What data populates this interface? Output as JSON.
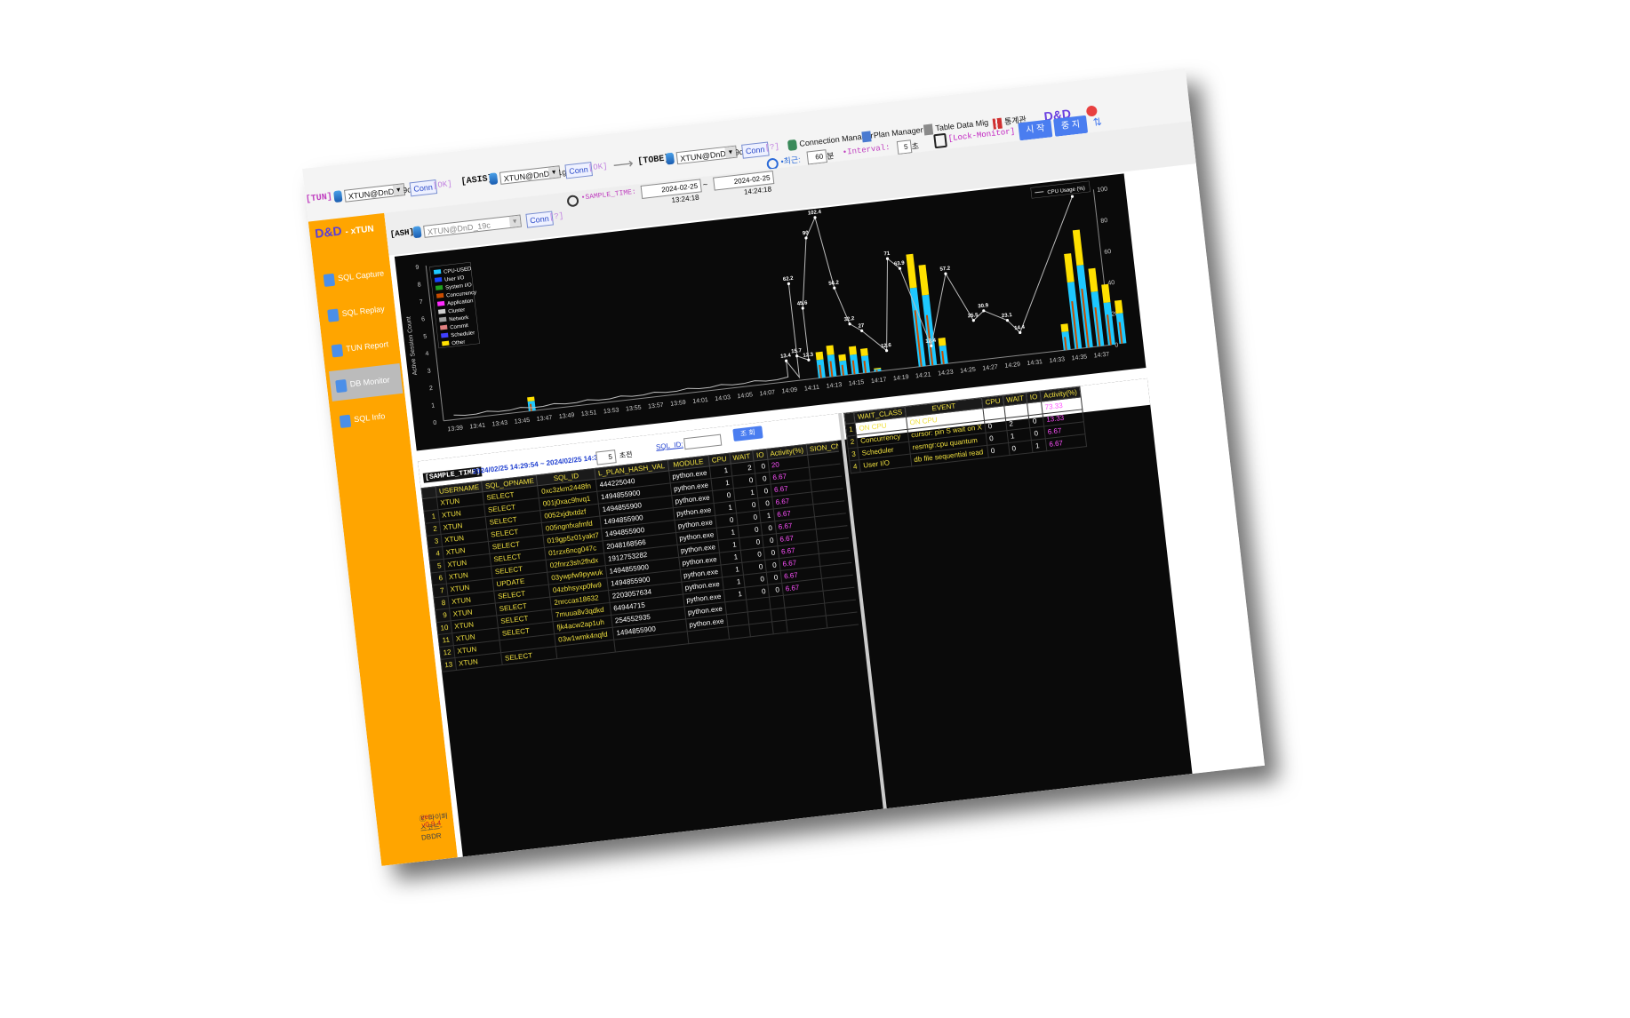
{
  "toolbar": {
    "tun_label": "[TUN]",
    "tun_db": "XTUN@DnD_19c",
    "tun_conn": "Conn",
    "tun_status": "[OK]",
    "asis_label": "[ASIS]",
    "asis_db": "XTUN@DnD_11g",
    "asis_conn": "Conn",
    "asis_status": "[OK]",
    "tobe_label": "[TOBE]",
    "tobe_db": "XTUN@DnD_19c",
    "tobe_conn": "Conn",
    "tobe_status": "[?]",
    "connection_manager": "Connection Manager",
    "plan_manager": "Plan Manager",
    "table_data_mig": "Table Data Mig",
    "tool_4": "통계관",
    "brand": "D&D",
    "recent_label": "•최근:",
    "recent_value": "60",
    "recent_unit": "분",
    "interval_label": "•Interval:",
    "interval_value": "5",
    "interval_unit": "초",
    "lock_monitor": "[Lock-Monitor]",
    "start_btn": "시 작",
    "stop_btn": "중 지"
  },
  "ash": {
    "label": "[ASH]",
    "db": "XTUN@DnD_19c",
    "conn": "Conn",
    "status": "[?]",
    "sample_time_label": "•SAMPLE_TIME:",
    "from": "2024-02-25 13:24:18",
    "sep": "~",
    "to": "2024-02-25 14:24:18"
  },
  "sidebar": {
    "logo": "D&D",
    "logo_suffix": "- xTUN",
    "items": [
      {
        "label": "SQL Capture",
        "icon": "capture-icon"
      },
      {
        "label": "SQL Replay",
        "icon": "replay-icon"
      },
      {
        "label": "TUN Report",
        "icon": "report-icon"
      },
      {
        "label": "DB Monitor",
        "icon": "monitor-icon"
      },
      {
        "label": "SQL Info",
        "icon": "info-icon"
      }
    ],
    "version": "ver.: v0.9.4",
    "copyright": "Ⓒ 라이퍼스코드-DBDR"
  },
  "chart_data": {
    "type": "area",
    "ylabel": "Active Session Count",
    "ylim": [
      0,
      9
    ],
    "y2lim": [
      0,
      100
    ],
    "y2ticks": [
      0,
      20,
      40,
      60,
      80,
      100
    ],
    "categories": [
      "13:39",
      "13:41",
      "13:43",
      "13:45",
      "13:47",
      "13:49",
      "13:51",
      "13:53",
      "13:55",
      "13:57",
      "13:59",
      "14:01",
      "14:03",
      "14:05",
      "14:07",
      "14:09",
      "14:11",
      "14:13",
      "14:15",
      "14:17",
      "14:19",
      "14:21",
      "14:23",
      "14:25",
      "14:27",
      "14:29",
      "14:31",
      "14:33",
      "14:35",
      "14:37"
    ],
    "legend": [
      "CPU-USED",
      "User I/O",
      "System I/O",
      "Concurrency",
      "Application",
      "Cluster",
      "Network",
      "Commit",
      "Scheduler",
      "Other"
    ],
    "colors": {
      "CPU-USED": "#1ec8ff",
      "User I/O": "#1a44ff",
      "System I/O": "#1fa01f",
      "Concurrency": "#c84c00",
      "Application": "#ff2bff",
      "Cluster": "#d0d0d0",
      "Network": "#a0a0a0",
      "Commit": "#e08080",
      "Scheduler": "#4040ff",
      "Other": "#ffe000"
    },
    "cpu_usage_legend": "CPU Usage (%)",
    "cpu_usage_labels": [
      {
        "x": "14:09",
        "y": 13.4
      },
      {
        "x": "14:10",
        "y": 62.2
      },
      {
        "x": "14:10",
        "y": 15.7
      },
      {
        "x": "14:11",
        "y": 12.3
      },
      {
        "x": "14:11",
        "y": 45.6
      },
      {
        "x": "14:12",
        "y": 90
      },
      {
        "x": "14:13",
        "y": 102.4
      },
      {
        "x": "14:14",
        "y": 56.2
      },
      {
        "x": "14:15",
        "y": 32.2
      },
      {
        "x": "14:16",
        "y": 27
      },
      {
        "x": "14:18",
        "y": 12.6
      },
      {
        "x": "14:19",
        "y": 71
      },
      {
        "x": "14:20",
        "y": 63.9
      },
      {
        "x": "14:22",
        "y": 12.4
      },
      {
        "x": "14:24",
        "y": 57.2
      },
      {
        "x": "14:26",
        "y": 25.5
      },
      {
        "x": "14:27",
        "y": 30.9
      },
      {
        "x": "14:29",
        "y": 23.1
      },
      {
        "x": "14:30",
        "y": 14.4
      },
      {
        "x": "14:36",
        "y": 97.1
      }
    ],
    "sessions_by_minute": [
      0,
      0,
      0,
      0,
      0,
      0,
      0,
      0.8,
      0,
      0,
      0,
      0,
      0,
      0,
      0,
      0,
      0,
      0,
      0,
      0,
      0,
      0,
      0,
      0,
      0,
      0,
      0,
      0,
      0,
      0,
      0,
      0,
      0,
      1.5,
      1.8,
      1.2,
      1.6,
      1.4,
      0.2,
      0,
      0,
      0,
      6.5,
      5.8,
      1.5,
      0,
      0,
      0,
      0,
      0,
      0,
      0,
      0,
      0,
      0,
      1.5,
      5.5,
      6.8,
      4.5,
      3.5,
      2.5
    ]
  },
  "lower_left": {
    "sample_time_label": "[SAMPLE_TIME]",
    "range": "2024/02/25 14:29:54 ~ 2024/02/25 14:30:52",
    "top_value": "5",
    "top_unit": "초전",
    "sql_id_label": "SQL_ID:",
    "query_btn": "조 회",
    "headers": [
      "",
      "USERNAME",
      "SQL_OPNAME",
      "SQL_ID",
      "L_PLAN_HASH_VAL",
      "MODULE",
      "CPU",
      "WAIT",
      "IO",
      "Activity(%)",
      "SION_CNT"
    ],
    "rows": [
      [
        "",
        "XTUN",
        "SELECT",
        "0xc3zkm2448fn",
        "444225040",
        "python.exe",
        "1",
        "2",
        "0",
        "20",
        "1"
      ],
      [
        "1",
        "XTUN",
        "SELECT",
        "001j0xac9hvq1",
        "1494855900",
        "python.exe",
        "1",
        "0",
        "0",
        "6.67",
        "1"
      ],
      [
        "2",
        "XTUN",
        "SELECT",
        "0052xjdtxtdzf",
        "1494855900",
        "python.exe",
        "0",
        "1",
        "0",
        "6.67",
        "1"
      ],
      [
        "3",
        "XTUN",
        "SELECT",
        "005ngnfxafmfd",
        "1494855900",
        "python.exe",
        "1",
        "0",
        "0",
        "6.67",
        "1"
      ],
      [
        "4",
        "XTUN",
        "SELECT",
        "019gp5z01yakt7",
        "1494855900",
        "python.exe",
        "0",
        "0",
        "1",
        "6.67",
        "1"
      ],
      [
        "5",
        "XTUN",
        "SELECT",
        "01rzx6ncg047c",
        "2048168566",
        "python.exe",
        "1",
        "0",
        "0",
        "6.67",
        "1"
      ],
      [
        "6",
        "XTUN",
        "SELECT",
        "02fnrz3sh2fhdx",
        "1912753282",
        "python.exe",
        "1",
        "0",
        "0",
        "6.67",
        "1"
      ],
      [
        "7",
        "XTUN",
        "UPDATE",
        "03ywpfw9pywuk",
        "1494855900",
        "python.exe",
        "1",
        "0",
        "0",
        "6.67",
        "1"
      ],
      [
        "8",
        "XTUN",
        "SELECT",
        "04zbhsyxp0fw9",
        "1494855900",
        "python.exe",
        "1",
        "0",
        "0",
        "6.67",
        "1"
      ],
      [
        "9",
        "XTUN",
        "SELECT",
        "2nrccas18632",
        "2203057634",
        "python.exe",
        "1",
        "0",
        "0",
        "6.67",
        "1"
      ],
      [
        "10",
        "XTUN",
        "SELECT",
        "7muua8v3qdkd",
        "64944715",
        "python.exe",
        "1",
        "0",
        "0",
        "6.67",
        "1"
      ],
      [
        "11",
        "XTUN",
        "SELECT",
        "fjk4acw2ap1uh",
        "254552935",
        "python.exe",
        "",
        "",
        "",
        "",
        ""
      ],
      [
        "12",
        "XTUN",
        "",
        "03w1wmk4nqfd",
        "1494855900",
        "python.exe",
        "",
        "",
        "",
        "",
        ""
      ],
      [
        "13",
        "XTUN",
        "SELECT",
        "",
        "",
        "",
        "",
        "",
        "",
        "",
        ""
      ]
    ]
  },
  "lower_right": {
    "headers": [
      "",
      "WAIT_CLASS",
      "EVENT",
      "CPU",
      "WAIT",
      "IO",
      "Activity(%)"
    ],
    "rows": [
      [
        "1",
        "ON CPU",
        "ON CPU",
        "11",
        "0",
        "0",
        "73.33"
      ],
      [
        "2",
        "Concurrency",
        "cursor: pin S wait on X",
        "0",
        "2",
        "0",
        "13.33"
      ],
      [
        "3",
        "Scheduler",
        "resmgr:cpu quantum",
        "0",
        "1",
        "0",
        "6.67"
      ],
      [
        "4",
        "User I/O",
        "db file sequential read",
        "0",
        "0",
        "1",
        "6.67"
      ]
    ]
  }
}
